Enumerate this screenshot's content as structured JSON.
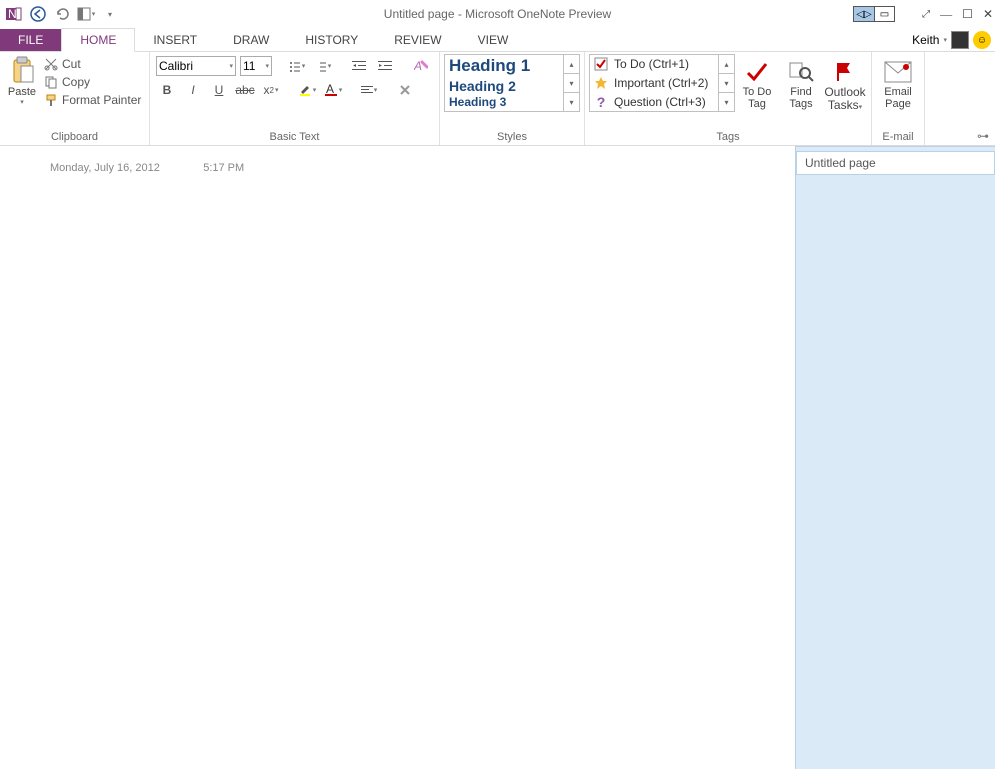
{
  "titlebar": {
    "title": "Untitled page - Microsoft OneNote Preview"
  },
  "user": {
    "name": "Keith"
  },
  "tabs": {
    "file": "FILE",
    "items": [
      "HOME",
      "INSERT",
      "DRAW",
      "HISTORY",
      "REVIEW",
      "VIEW"
    ]
  },
  "clipboard": {
    "group": "Clipboard",
    "paste": "Paste",
    "cut": "Cut",
    "copy": "Copy",
    "formatpainter": "Format Painter"
  },
  "basictext": {
    "group": "Basic Text",
    "fontname": "Calibri",
    "fontsize": "11"
  },
  "styles": {
    "group": "Styles",
    "items": [
      "Heading 1",
      "Heading 2",
      "Heading 3"
    ]
  },
  "tags": {
    "group": "Tags",
    "items": [
      {
        "label": "To Do (Ctrl+1)"
      },
      {
        "label": "Important (Ctrl+2)"
      },
      {
        "label": "Question (Ctrl+3)"
      }
    ],
    "todo": "To Do Tag",
    "find": "Find Tags",
    "outlook": "Outlook Tasks"
  },
  "email": {
    "group": "E-mail",
    "emailpage": "Email Page"
  },
  "page": {
    "date": "Monday, July 16, 2012",
    "time": "5:17 PM"
  },
  "sidepane": {
    "pagetitle": "Untitled page"
  }
}
